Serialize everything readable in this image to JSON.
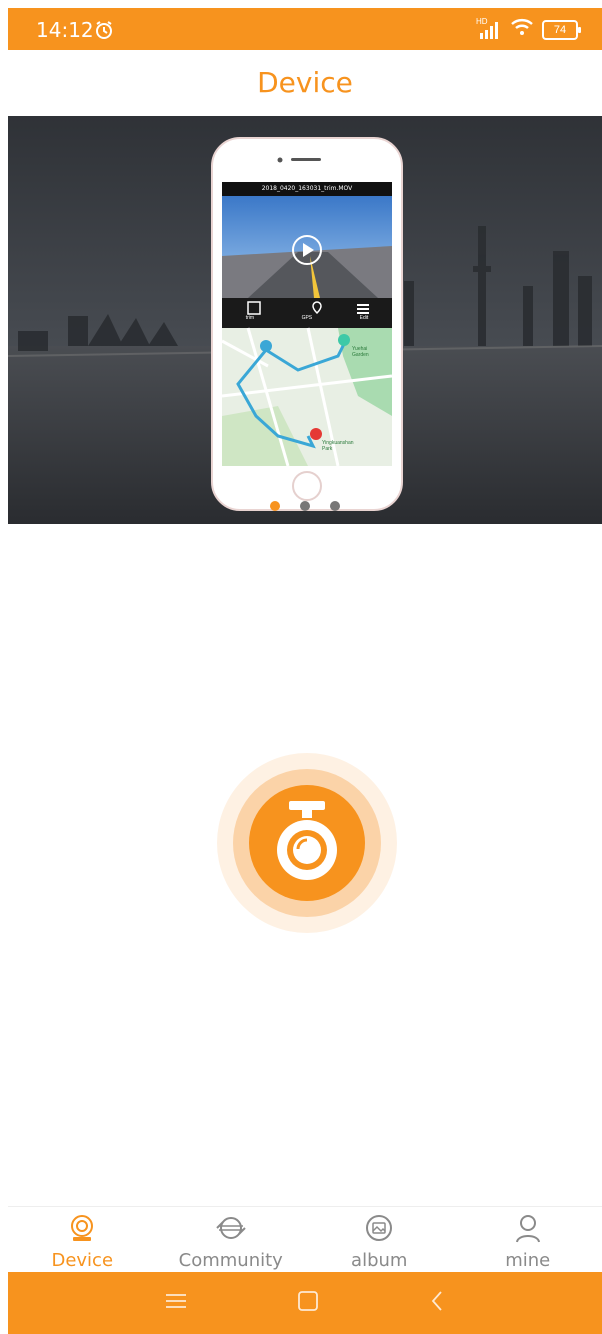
{
  "status_bar": {
    "time": "14:12",
    "signal_label": "HD",
    "battery": "74"
  },
  "header": {
    "title": "Device"
  },
  "banner": {
    "preview": {
      "file_name": "2018_0420_163031_trim.MOV",
      "actions": [
        "trim",
        "GPS",
        "Edit"
      ],
      "map_labels": [
        "Yuehai Garden",
        "Yingkuanshan Park"
      ]
    },
    "pagination": {
      "count": 3,
      "active": 0
    }
  },
  "tabs": [
    {
      "label": "Device",
      "icon": "camera-icon",
      "active": true
    },
    {
      "label": "Community",
      "icon": "community-icon",
      "active": false
    },
    {
      "label": "album",
      "icon": "album-icon",
      "active": false
    },
    {
      "label": "mine",
      "icon": "person-icon",
      "active": false
    }
  ],
  "colors": {
    "accent": "#F7931E",
    "inactive": "#8a8a8a"
  }
}
